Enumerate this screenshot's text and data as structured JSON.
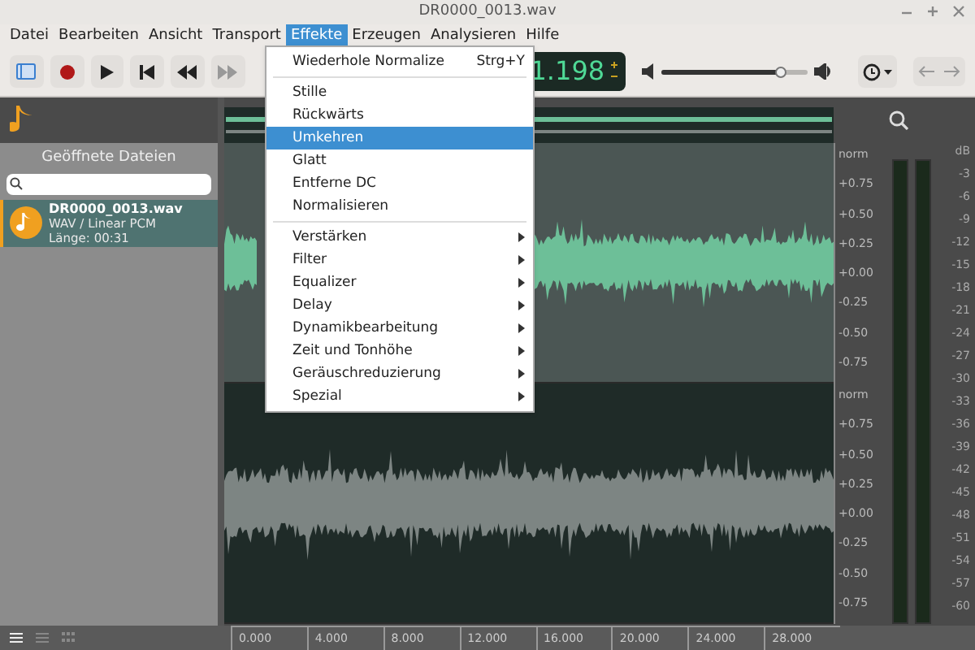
{
  "window": {
    "title": "DR0000_0013.wav"
  },
  "menubar": [
    {
      "label": "Datei",
      "selected": false
    },
    {
      "label": "Bearbeiten",
      "selected": false
    },
    {
      "label": "Ansicht",
      "selected": false
    },
    {
      "label": "Transport",
      "selected": false
    },
    {
      "label": "Effekte",
      "selected": true
    },
    {
      "label": "Erzeugen",
      "selected": false
    },
    {
      "label": "Analysieren",
      "selected": false
    },
    {
      "label": "Hilfe",
      "selected": false
    }
  ],
  "toolbar": {
    "time": "1.198",
    "volume": {
      "level": 0.82
    }
  },
  "effects_menu": [
    {
      "kind": "command",
      "label": "Wiederhole Normalize",
      "shortcut": "Strg+Y",
      "selected": false
    },
    {
      "kind": "separator"
    },
    {
      "kind": "command",
      "label": "Stille",
      "selected": false
    },
    {
      "kind": "command",
      "label": "Rückwärts",
      "selected": false
    },
    {
      "kind": "command",
      "label": "Umkehren",
      "selected": true
    },
    {
      "kind": "command",
      "label": "Glatt",
      "selected": false
    },
    {
      "kind": "command",
      "label": "Entferne DC",
      "selected": false
    },
    {
      "kind": "command",
      "label": "Normalisieren",
      "selected": false
    },
    {
      "kind": "separator"
    },
    {
      "kind": "submenu",
      "label": "Verstärken",
      "selected": false
    },
    {
      "kind": "submenu",
      "label": "Filter",
      "selected": false
    },
    {
      "kind": "submenu",
      "label": "Equalizer",
      "selected": false
    },
    {
      "kind": "submenu",
      "label": "Delay",
      "selected": false
    },
    {
      "kind": "submenu",
      "label": "Dynamikbearbeitung",
      "selected": false
    },
    {
      "kind": "submenu",
      "label": "Zeit und Tonhöhe",
      "selected": false
    },
    {
      "kind": "submenu",
      "label": "Geräuschreduzierung",
      "selected": false
    },
    {
      "kind": "submenu",
      "label": "Spezial",
      "selected": false
    }
  ],
  "sidebar": {
    "title": "Geöffnete Dateien",
    "files": [
      {
        "name": "DR0000_0013.wav",
        "format": "WAV / Linear PCM",
        "length": "Länge: 00:31",
        "selected": true
      }
    ]
  },
  "channels": [
    {
      "selected": true,
      "scale": [
        "norm",
        "+0.75",
        "+0.50",
        "+0.25",
        "+0.00",
        "-0.25",
        "-0.50",
        "-0.75"
      ]
    },
    {
      "selected": false,
      "scale": [
        "norm",
        "+0.75",
        "+0.50",
        "+0.25",
        "+0.00",
        "-0.25",
        "-0.50",
        "-0.75"
      ]
    }
  ],
  "timeline": [
    "0.000",
    "4.000",
    "8.000",
    "12.000",
    "16.000",
    "20.000",
    "24.000",
    "28.000"
  ],
  "meter": [
    "dB",
    "-3",
    "-6",
    "-9",
    "-12",
    "-15",
    "-18",
    "-21",
    "-24",
    "-27",
    "-30",
    "-33",
    "-36",
    "-39",
    "-42",
    "-45",
    "-48",
    "-51",
    "-54",
    "-57",
    "-60"
  ]
}
